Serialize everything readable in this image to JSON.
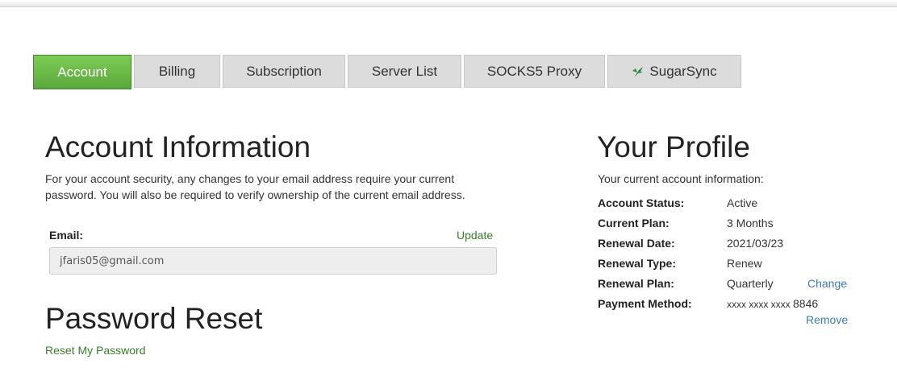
{
  "tabs": [
    {
      "label": "Account",
      "active": true
    },
    {
      "label": "Billing"
    },
    {
      "label": "Subscription"
    },
    {
      "label": "Server List"
    },
    {
      "label": "SOCKS5 Proxy"
    },
    {
      "label": "SugarSync",
      "icon": "sugarsync-leaf-icon"
    }
  ],
  "account": {
    "title": "Account Information",
    "description": "For your account security, any changes to your email address require your current password. You will also be required to verify ownership of the current email address.",
    "email_label": "Email:",
    "update_label": "Update",
    "email_value": "jfaris05@gmail.com"
  },
  "password": {
    "title": "Password Reset",
    "reset_link": "Reset My Password"
  },
  "profile": {
    "title": "Your Profile",
    "intro": "Your current account information:",
    "rows": [
      {
        "key": "Account Status:",
        "value": "Active"
      },
      {
        "key": "Current Plan:",
        "value": "3 Months"
      },
      {
        "key": "Renewal Date:",
        "value": "2021/03/23"
      },
      {
        "key": "Renewal Type:",
        "value": "Renew"
      },
      {
        "key": "Renewal Plan:",
        "value": "Quarterly",
        "action": "Change"
      },
      {
        "key": "Payment Method:",
        "value_masked": "xxxx xxxx xxxx",
        "value_last4": "8846",
        "action": "Remove"
      }
    ]
  },
  "colors": {
    "active_tab": "#5aa93a",
    "green_link": "#3b7d2b",
    "blue_link": "#3a7bbf"
  }
}
